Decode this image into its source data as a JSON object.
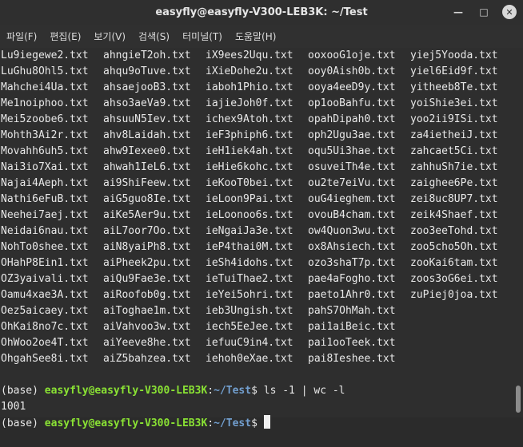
{
  "window": {
    "title": "easyfly@easyfly-V300-LEB3K: ~/Test",
    "minimize_glyph": "—",
    "maximize_glyph": "□",
    "close_glyph": "✕"
  },
  "menu": [
    "파일(F)",
    "편집(E)",
    "보기(V)",
    "검색(S)",
    "터미널(T)",
    "도움말(H)"
  ],
  "listing_rows": [
    [
      "Lu9iegewe2.txt",
      "ahngieT2oh.txt",
      "iX9ees2Uqu.txt",
      "ooxooG1oje.txt",
      "yiej5Yooda.txt"
    ],
    [
      "LuGhu8Ohl5.txt",
      "ahqu9oTuve.txt",
      "iXieDohe2u.txt",
      "ooy0Aish0b.txt",
      "yiel6Eid9f.txt"
    ],
    [
      "Mahchei4Ua.txt",
      "ahsaejooB3.txt",
      "iaboh1Phio.txt",
      "ooya4eeD9y.txt",
      "yitheeb8Te.txt"
    ],
    [
      "Me1noiphoo.txt",
      "ahso3aeVa9.txt",
      "iajieJoh0f.txt",
      "op1ooBahfu.txt",
      "yoiShie3ei.txt"
    ],
    [
      "Mei5zoobe6.txt",
      "ahsuuN5Iev.txt",
      "ichex9Atoh.txt",
      "opahDipah0.txt",
      "yoo2ii9ISi.txt"
    ],
    [
      "Mohth3Ai2r.txt",
      "ahv8Laidah.txt",
      "ieF3phiph6.txt",
      "oph2Ugu3ae.txt",
      "za4ietheiJ.txt"
    ],
    [
      "Movahh6uh5.txt",
      "ahw9Iexee0.txt",
      "ieH1iek4ah.txt",
      "oqu5Ui3hae.txt",
      "zahcaet5Ci.txt"
    ],
    [
      "Nai3io7Xai.txt",
      "ahwah1IeL6.txt",
      "ieHie6kohc.txt",
      "osuveiTh4e.txt",
      "zahhuSh7ie.txt"
    ],
    [
      "Najai4Aeph.txt",
      "ai9ShiFeew.txt",
      "ieKooT0bei.txt",
      "ou2te7eiVu.txt",
      "zaighee6Pe.txt"
    ],
    [
      "Nathi6eFuB.txt",
      "aiG5guo8Ie.txt",
      "ieLoon9Pai.txt",
      "ouG4ieghem.txt",
      "zei8uc8UP7.txt"
    ],
    [
      "Neehei7aej.txt",
      "aiKe5Aer9u.txt",
      "ieLoonoo6s.txt",
      "ovouB4cham.txt",
      "zeik4Shaef.txt"
    ],
    [
      "Neidai6nau.txt",
      "aiL7oor7Oo.txt",
      "ieNgaiJa3e.txt",
      "ow4Quon3wu.txt",
      "zoo3eeTohd.txt"
    ],
    [
      "NohTo0shee.txt",
      "aiN8yaiPh8.txt",
      "ieP4thai0M.txt",
      "ox8Ahsiech.txt",
      "zoo5cho5Oh.txt"
    ],
    [
      "OHahP8Ein1.txt",
      "aiPheek2pu.txt",
      "ieSh4idohs.txt",
      "ozo3shaT7p.txt",
      "zooKai6tam.txt"
    ],
    [
      "OZ3yaivali.txt",
      "aiQu9Fae3e.txt",
      "ieTuiThae2.txt",
      "pae4aFogho.txt",
      "zoos3oG6ei.txt"
    ],
    [
      "Oamu4xae3A.txt",
      "aiRoofob0g.txt",
      "ieYei5ohri.txt",
      "paeto1Ahr0.txt",
      "zuPiej0joa.txt"
    ],
    [
      "Oez5aicaey.txt",
      "aiToghae1m.txt",
      "ieb3Ungish.txt",
      "pahS7OhMah.txt",
      ""
    ],
    [
      "OhKai8no7c.txt",
      "aiVahvoo3w.txt",
      "iech5EeJee.txt",
      "pai1aiBeic.txt",
      ""
    ],
    [
      "OhWoo2oe4T.txt",
      "aiYeeve8he.txt",
      "iefuuC9in4.txt",
      "pai1ooTeek.txt",
      ""
    ],
    [
      "OhgahSee8i.txt",
      "aiZ5bahzea.txt",
      "iehoh0eXae.txt",
      "pai8Ieshee.txt",
      ""
    ]
  ],
  "command": {
    "env": "(base) ",
    "user_host": "easyfly@easyfly-V300-LEB3K",
    "sep": ":",
    "path": "~/Test",
    "dollar": "$ ",
    "text": "ls -1 | wc -l",
    "output": "1001"
  },
  "prompt2": {
    "env": "(base) ",
    "user_host": "easyfly@easyfly-V300-LEB3K",
    "sep": ":",
    "path": "~/Test",
    "dollar": "$ "
  },
  "colors": {
    "prompt_user": "#8ae234",
    "prompt_path": "#729fcf",
    "background": "#2e2e2e"
  }
}
